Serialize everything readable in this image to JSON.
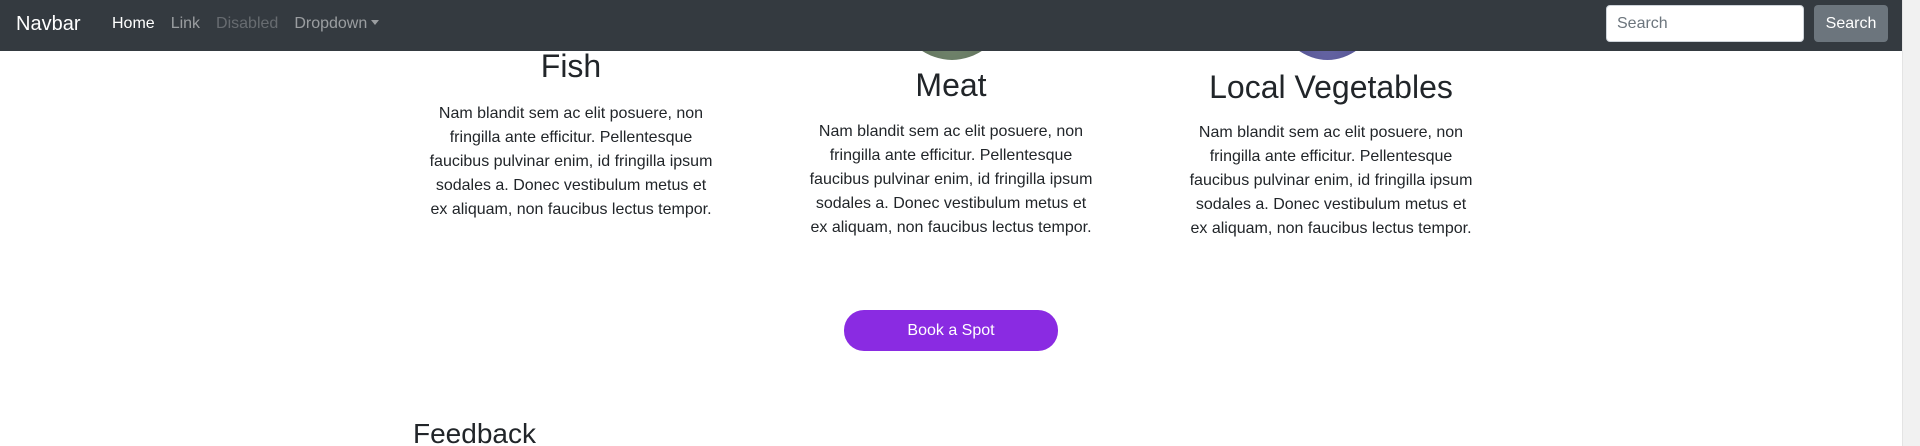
{
  "navbar": {
    "brand": "Navbar",
    "links": [
      {
        "label": "Home",
        "state": "active"
      },
      {
        "label": "Link",
        "state": "normal"
      },
      {
        "label": "Disabled",
        "state": "disabled"
      },
      {
        "label": "Dropdown",
        "state": "dropdown"
      }
    ],
    "search": {
      "placeholder": "Search",
      "value": "",
      "button_label": "Search"
    }
  },
  "menu": {
    "items": [
      {
        "title": "Fish",
        "text": "Nam blandit sem ac elit posuere, non fringilla ante efficitur. Pellentesque faucibus pulvinar enim, id fringilla ipsum sodales a. Donec vestibulum metus et ex aliquam, non faucibus lectus tempor."
      },
      {
        "title": "Meat",
        "text": "Nam blandit sem ac elit posuere, non fringilla ante efficitur. Pellentesque faucibus pulvinar enim, id fringilla ipsum sodales a. Donec vestibulum metus et ex aliquam, non faucibus lectus tempor."
      },
      {
        "title": "Local Vegetables",
        "text": "Nam blandit sem ac elit posuere, non fringilla ante efficitur. Pellentesque faucibus pulvinar enim, id fringilla ipsum sodales a. Donec vestibulum metus et ex aliquam, non faucibus lectus tempor."
      }
    ],
    "book_button_label": "Book a Spot"
  },
  "feedback": {
    "title": "Feedback"
  },
  "colors": {
    "navbar_bg": "#343a40",
    "accent": "#8a2be2",
    "search_button": "#6c757d"
  }
}
